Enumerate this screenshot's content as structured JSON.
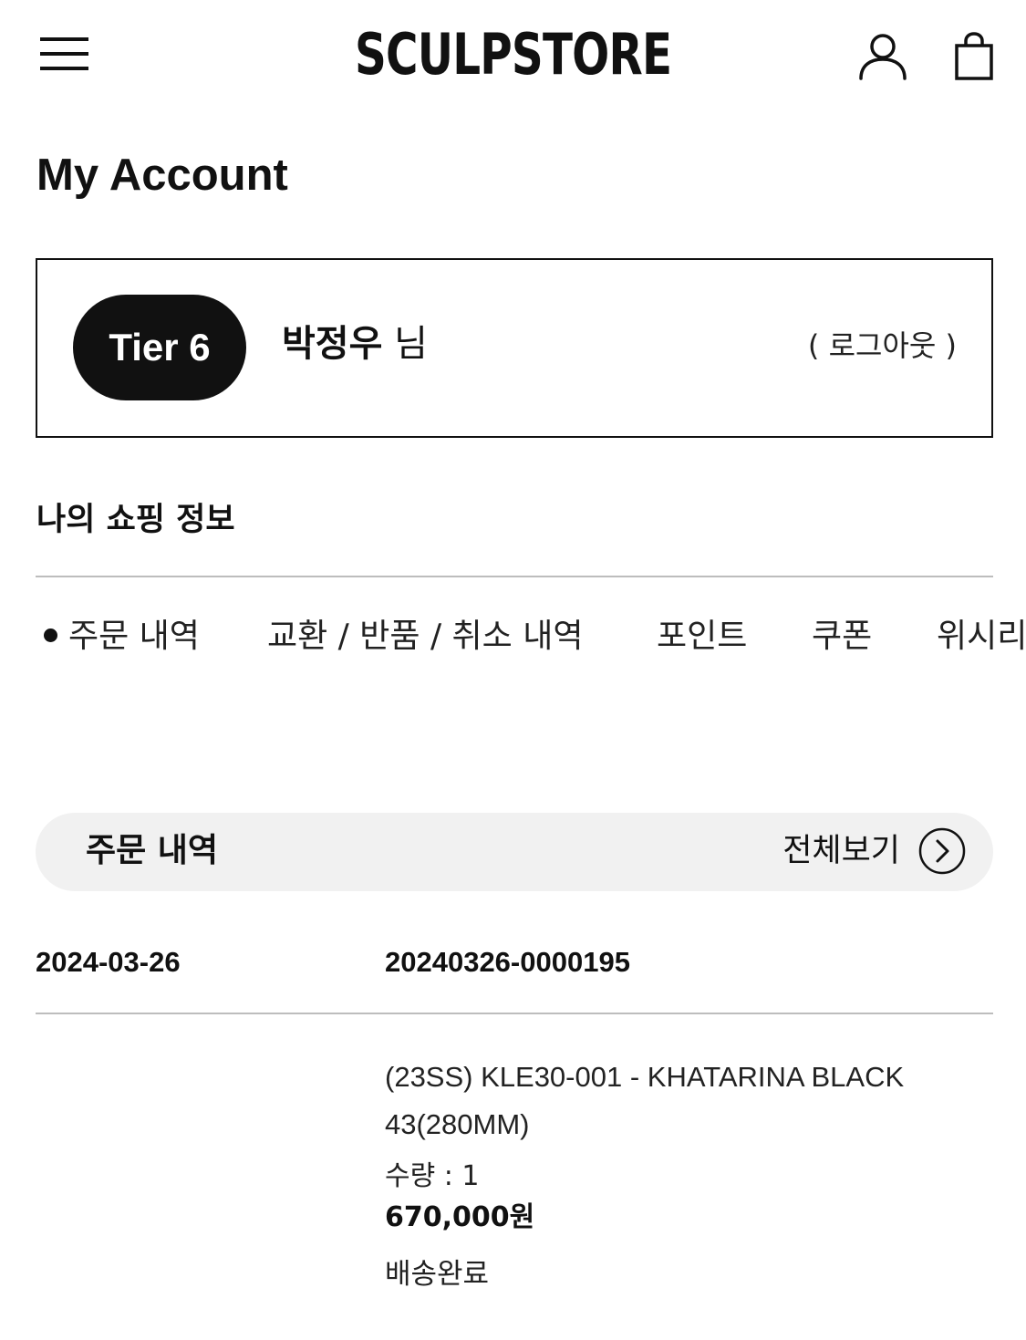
{
  "header": {
    "menu_icon": "hamburger-menu-icon",
    "logo": "SCULPSTORE",
    "account_icon": "user-icon",
    "cart_icon": "shopping-bag-icon"
  },
  "page_title": "My Account",
  "profile": {
    "tier": "Tier 6",
    "name": "박정우",
    "honorific": "님",
    "logout": "( 로그아웃 )"
  },
  "shopping_info": {
    "title": "나의 쇼핑 정보",
    "tabs": [
      {
        "label": "주문 내역",
        "active": true
      },
      {
        "label": "교환 / 반품 / 취소 내역",
        "active": false
      },
      {
        "label": "포인트",
        "active": false
      },
      {
        "label": "쿠폰",
        "active": false
      },
      {
        "label": "위시리스트",
        "active": false
      }
    ]
  },
  "orders": {
    "title": "주문 내역",
    "view_all": "전체보기",
    "view_all_icon": "chevron-right-circle-icon",
    "items": [
      {
        "date": "2024-03-26",
        "order_number": "20240326-0000195",
        "product_line1": "(23SS) KLE30-001 - KHATARINA BLACK",
        "product_line2": "43(280MM)",
        "quantity": "수량 : 1",
        "price": "670,000원",
        "status": "배송완료"
      }
    ]
  },
  "colors": {
    "text": "#111111",
    "badge_bg": "#111111",
    "bar_bg": "#f1f1f1",
    "divider": "#bdbdbd"
  }
}
